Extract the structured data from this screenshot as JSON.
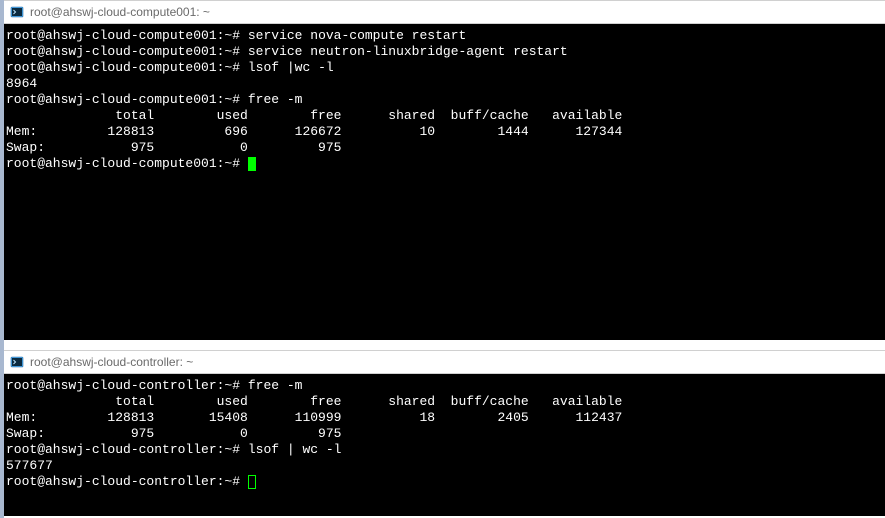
{
  "windows": [
    {
      "title": "root@ahswj-cloud-compute001: ~",
      "prompt": "root@ahswj-cloud-compute001:~#",
      "lines": [
        {
          "type": "cmd",
          "text": "service nova-compute restart"
        },
        {
          "type": "cmd",
          "text": "service neutron-linuxbridge-agent restart"
        },
        {
          "type": "cmd",
          "text": "lsof |wc -l"
        },
        {
          "type": "out",
          "text": "8964"
        },
        {
          "type": "cmd",
          "text": "free -m"
        }
      ],
      "free_header": "              total        used        free      shared  buff/cache   available",
      "free_rows": [
        "Mem:         128813         696      126672          10        1444      127344",
        "Swap:           975           0         975"
      ],
      "cursor": "solid"
    },
    {
      "title": "root@ahswj-cloud-controller: ~",
      "prompt": "root@ahswj-cloud-controller:~#",
      "lines": [
        {
          "type": "cmd",
          "text": "free -m"
        }
      ],
      "free_header": "              total        used        free      shared  buff/cache   available",
      "free_rows": [
        "Mem:         128813       15408      110999          18        2405      112437",
        "Swap:           975           0         975"
      ],
      "lines_after": [
        {
          "type": "cmd",
          "text": "lsof | wc -l"
        },
        {
          "type": "out",
          "text": "577677"
        }
      ],
      "cursor": "outline"
    }
  ]
}
